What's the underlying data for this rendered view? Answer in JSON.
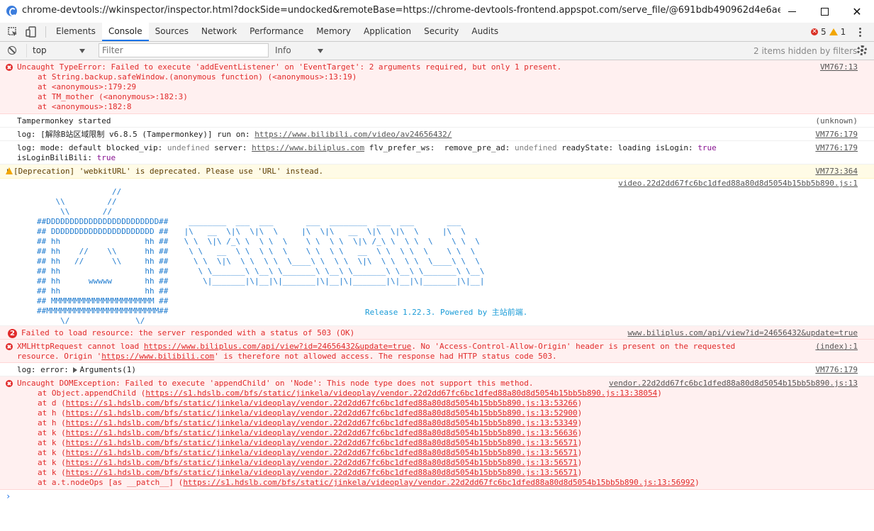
{
  "window": {
    "title": "chrome-devtools://wkinspector/inspector.html?dockSide=undocked&remoteBase=https://chrome-devtools-frontend.appspot.com/serve_file/@691bdb490962d4e6ae7f25c6ab1fdd0..."
  },
  "tabs": [
    "Elements",
    "Console",
    "Sources",
    "Network",
    "Performance",
    "Memory",
    "Application",
    "Security",
    "Audits"
  ],
  "active_tab": "Console",
  "counts": {
    "errors": "5",
    "warnings": "1"
  },
  "filterbar": {
    "context": "top",
    "filter_placeholder": "Filter",
    "levels": "Info",
    "hidden": "2 items hidden by filters"
  },
  "messages": {
    "m1": {
      "text": "Uncaught TypeError: Failed to execute 'addEventListener' on 'EventTarget': 2 arguments required, but only 1 present.",
      "stack": [
        "at String.backup.safeWindow.(anonymous function) (<anonymous>:13:19)",
        "at <anonymous>:179:29",
        "at TM_mother (<anonymous>:182:3)",
        "at <anonymous>:182:8"
      ],
      "source": "VM767:13"
    },
    "m2": {
      "text": "Tampermonkey started",
      "source": "(unknown)"
    },
    "m3": {
      "prefix": "log: [解除B站区域限制 v6.8.5 (Tampermonkey)] run on: ",
      "link": "https://www.bilibili.com/video/av24656432/",
      "source": "VM776:179"
    },
    "m4": {
      "p1": "log: mode: default blocked_vip: ",
      "v1": "undefined",
      "p2": " server: ",
      "link": "https://www.biliplus.com",
      "p3": " flv_prefer_ws:  remove_pre_ad: ",
      "v2": "undefined",
      "p4": " readyState: loading isLogin: ",
      "v3": "true",
      "p5": "isLoginBiliBili: ",
      "v4": "true",
      "source": "VM776:179"
    },
    "m5": {
      "text": "[Deprecation] 'webkitURL' is deprecated. Please use 'URL' instead.",
      "source": "VM773:364"
    },
    "m6": {
      "source": "video.22d2dd67fc6bc1dfed88a80d8d5054b15bb5b890.js:1",
      "art_left": "                //\n    \\\\         //\n     \\\\       //\n##DDDDDDDDDDDDDDDDDDDDDDDD##\n## DDDDDDDDDDDDDDDDDDDDDD ##\n## hh                  hh ##\n## hh    //    \\\\      hh ##\n## hh   //      \\\\     hh ##\n## hh                  hh ##\n## hh      wwwww       hh ##\n## hh                  hh ##\n## MMMMMMMMMMMMMMMMMMMMMM ##\n##MMMMMMMMMMMMMMMMMMMMMMMM##\n     \\/              \\/",
      "art_right": "  ________  ___  ___       ___  ________  ___  ___       ___\n |\\   __  \\|\\  \\|\\  \\     |\\  \\|\\   __  \\|\\  \\|\\  \\     |\\  \\\n \\ \\  \\|\\ /_\\ \\  \\ \\  \\    \\ \\  \\ \\  \\|\\ /_\\ \\  \\ \\  \\    \\ \\  \\\n  \\ \\   __  \\ \\  \\ \\  \\    \\ \\  \\ \\   __  \\ \\  \\ \\  \\    \\ \\  \\\n   \\ \\  \\|\\  \\ \\  \\ \\  \\____\\ \\  \\ \\  \\|\\  \\ \\  \\ \\  \\____\\ \\  \\\n    \\ \\_______\\ \\__\\ \\_______\\ \\__\\ \\_______\\ \\__\\ \\_______\\ \\__\\\n     \\|_______|\\|__|\\|_______|\\|__|\\|_______|\\|__|\\|_______|\\|__|",
      "release": "Release 1.22.3. Powered by 主站前端."
    },
    "m7": {
      "badge": "2",
      "text": "Failed to load resource: the server responded with a status of 503 (OK)",
      "source": "www.biliplus.com/api/view?id=24656432&update=true"
    },
    "m8": {
      "p1": "XMLHttpRequest cannot load ",
      "link1": "https://www.biliplus.com/api/view?id=24656432&update=true",
      "p2": ". No 'Access-Control-Allow-Origin' header is present on the requested",
      "p3": "resource. Origin '",
      "link2": "https://www.bilibili.com",
      "p4": "' is therefore not allowed access. The response had HTTP status code 503.",
      "source": "(index):1"
    },
    "m9": {
      "prefix": "log: error: ",
      "text": "Arguments(1)",
      "source": "VM776:179"
    },
    "m10": {
      "text": "Uncaught DOMException: Failed to execute 'appendChild' on 'Node': This node type does not support this method.",
      "source": "vendor.22d2dd67fc6bc1dfed88a80d8d5054b15bb5b890.js:13",
      "stack": [
        {
          "pre": "at Object.appendChild (",
          "link": "https://s1.hdslb.com/bfs/static/jinkela/videoplay/vendor.22d2dd67fc6bc1dfed88a80d8d5054b15bb5b890.js:13:38054",
          "post": ")"
        },
        {
          "pre": "at d (",
          "link": "https://s1.hdslb.com/bfs/static/jinkela/videoplay/vendor.22d2dd67fc6bc1dfed88a80d8d5054b15bb5b890.js:13:53266",
          "post": ")"
        },
        {
          "pre": "at h (",
          "link": "https://s1.hdslb.com/bfs/static/jinkela/videoplay/vendor.22d2dd67fc6bc1dfed88a80d8d5054b15bb5b890.js:13:52900",
          "post": ")"
        },
        {
          "pre": "at h (",
          "link": "https://s1.hdslb.com/bfs/static/jinkela/videoplay/vendor.22d2dd67fc6bc1dfed88a80d8d5054b15bb5b890.js:13:53349",
          "post": ")"
        },
        {
          "pre": "at k (",
          "link": "https://s1.hdslb.com/bfs/static/jinkela/videoplay/vendor.22d2dd67fc6bc1dfed88a80d8d5054b15bb5b890.js:13:56636",
          "post": ")"
        },
        {
          "pre": "at k (",
          "link": "https://s1.hdslb.com/bfs/static/jinkela/videoplay/vendor.22d2dd67fc6bc1dfed88a80d8d5054b15bb5b890.js:13:56571",
          "post": ")"
        },
        {
          "pre": "at k (",
          "link": "https://s1.hdslb.com/bfs/static/jinkela/videoplay/vendor.22d2dd67fc6bc1dfed88a80d8d5054b15bb5b890.js:13:56571",
          "post": ")"
        },
        {
          "pre": "at k (",
          "link": "https://s1.hdslb.com/bfs/static/jinkela/videoplay/vendor.22d2dd67fc6bc1dfed88a80d8d5054b15bb5b890.js:13:56571",
          "post": ")"
        },
        {
          "pre": "at k (",
          "link": "https://s1.hdslb.com/bfs/static/jinkela/videoplay/vendor.22d2dd67fc6bc1dfed88a80d8d5054b15bb5b890.js:13:56571",
          "post": ")"
        },
        {
          "pre": "at a.t.nodeOps [as __patch__] (",
          "link": "https://s1.hdslb.com/bfs/static/jinkela/videoplay/vendor.22d2dd67fc6bc1dfed88a80d8d5054b15bb5b890.js:13:56992",
          "post": ")"
        }
      ]
    }
  },
  "prompt": "›",
  "colors": {
    "error_bg": "#fff0f0",
    "error_text": "#e12a2a",
    "warn_bg": "#fffbe6",
    "accent": "#1a73e8"
  }
}
